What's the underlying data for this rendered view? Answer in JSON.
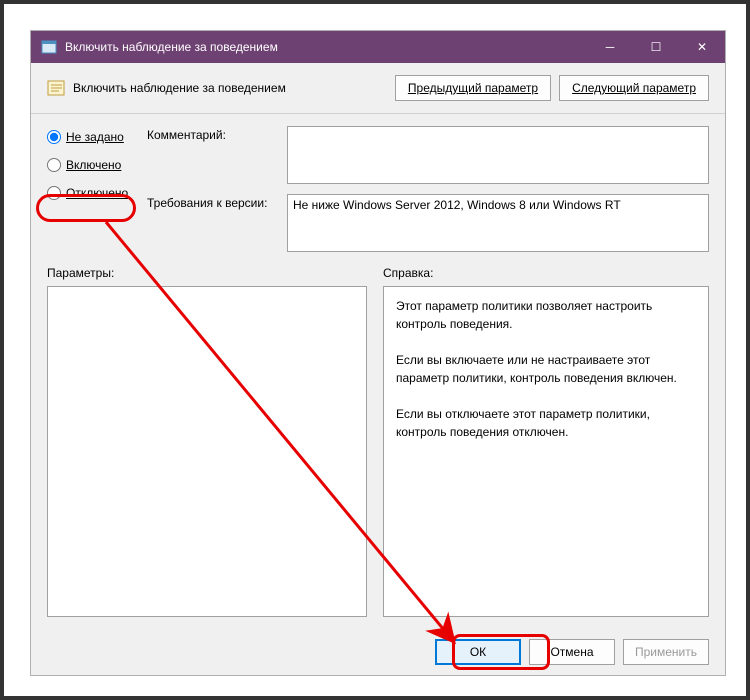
{
  "titlebar": {
    "title": "Включить наблюдение за поведением"
  },
  "toolbar": {
    "title": "Включить наблюдение за поведением",
    "prev": "Предыдущий параметр",
    "next": "Следующий параметр"
  },
  "radios": {
    "not_configured": "Не задано",
    "enabled": "Включено",
    "disabled": "Отключено"
  },
  "fields": {
    "comment_label": "Комментарий:",
    "comment_value": "",
    "requirements_label": "Требования к версии:",
    "requirements_value": "Не ниже Windows Server 2012, Windows 8 или Windows RT"
  },
  "lower": {
    "params_label": "Параметры:",
    "help_label": "Справка:",
    "help_text": "Этот параметр политики позволяет настроить контроль поведения.\n\nЕсли вы включаете или не настраиваете этот параметр политики, контроль поведения включен.\n\nЕсли вы отключаете этот параметр политики, контроль поведения отключен."
  },
  "footer": {
    "ok": "ОК",
    "cancel": "Отмена",
    "apply": "Применить"
  }
}
